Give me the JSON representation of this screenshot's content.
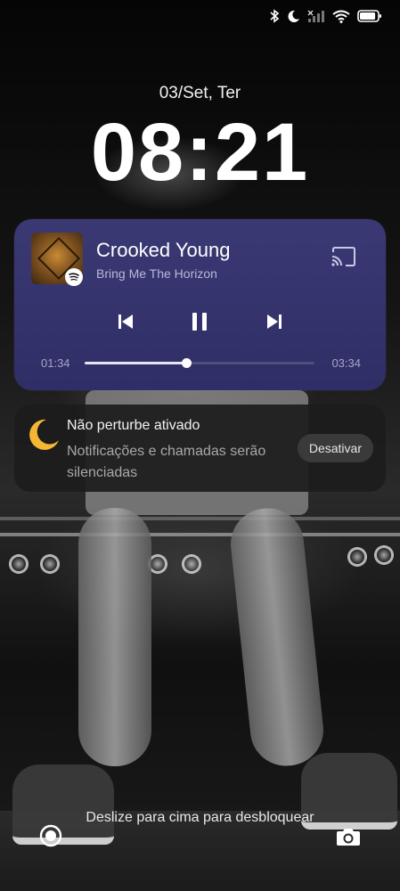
{
  "status_bar": {
    "icons": [
      "bluetooth-icon",
      "moon-icon",
      "signal-icon",
      "wifi-icon",
      "battery-icon"
    ],
    "battery_level": 0.9
  },
  "lockscreen": {
    "date": "03/Set, Ter",
    "time": "08:21"
  },
  "media": {
    "title": "Crooked Young",
    "artist": "Bring Me The Horizon",
    "elapsed": "01:34",
    "duration": "03:34",
    "progress": 0.44,
    "app_icon": "spotify-icon",
    "colors": {
      "card": "#3a3974",
      "accent": "#ffffff"
    }
  },
  "dnd": {
    "title": "Não perturbe ativado",
    "body": "Notificações e chamadas serão silenciadas",
    "button_label": "Desativar"
  },
  "bottom": {
    "hint": "Deslize para cima para desbloquear",
    "left_icon": "assistant-icon",
    "right_icon": "camera-icon"
  }
}
